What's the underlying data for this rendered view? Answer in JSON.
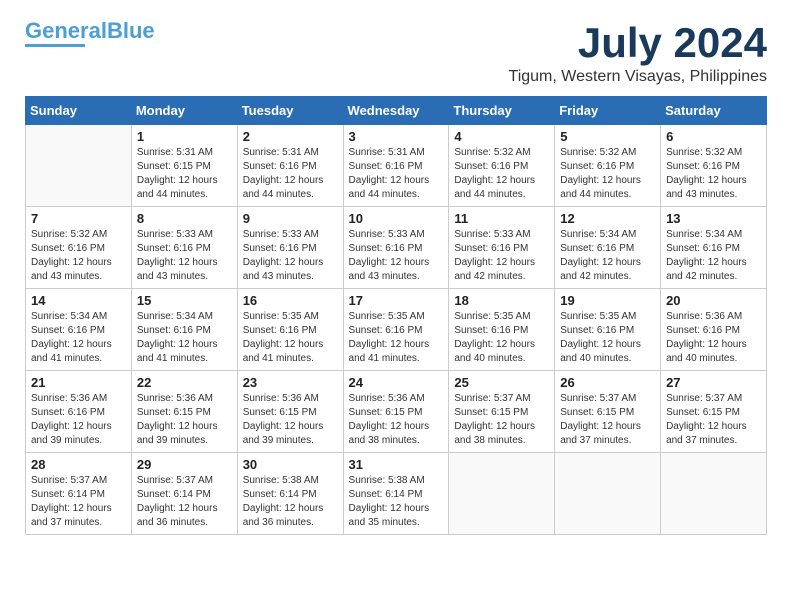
{
  "logo": {
    "line1": "General",
    "line2": "Blue"
  },
  "title": "July 2024",
  "location": "Tigum, Western Visayas, Philippines",
  "days_of_week": [
    "Sunday",
    "Monday",
    "Tuesday",
    "Wednesday",
    "Thursday",
    "Friday",
    "Saturday"
  ],
  "weeks": [
    [
      {
        "day": "",
        "info": ""
      },
      {
        "day": "1",
        "info": "Sunrise: 5:31 AM\nSunset: 6:15 PM\nDaylight: 12 hours\nand 44 minutes."
      },
      {
        "day": "2",
        "info": "Sunrise: 5:31 AM\nSunset: 6:16 PM\nDaylight: 12 hours\nand 44 minutes."
      },
      {
        "day": "3",
        "info": "Sunrise: 5:31 AM\nSunset: 6:16 PM\nDaylight: 12 hours\nand 44 minutes."
      },
      {
        "day": "4",
        "info": "Sunrise: 5:32 AM\nSunset: 6:16 PM\nDaylight: 12 hours\nand 44 minutes."
      },
      {
        "day": "5",
        "info": "Sunrise: 5:32 AM\nSunset: 6:16 PM\nDaylight: 12 hours\nand 44 minutes."
      },
      {
        "day": "6",
        "info": "Sunrise: 5:32 AM\nSunset: 6:16 PM\nDaylight: 12 hours\nand 43 minutes."
      }
    ],
    [
      {
        "day": "7",
        "info": "Sunrise: 5:32 AM\nSunset: 6:16 PM\nDaylight: 12 hours\nand 43 minutes."
      },
      {
        "day": "8",
        "info": "Sunrise: 5:33 AM\nSunset: 6:16 PM\nDaylight: 12 hours\nand 43 minutes."
      },
      {
        "day": "9",
        "info": "Sunrise: 5:33 AM\nSunset: 6:16 PM\nDaylight: 12 hours\nand 43 minutes."
      },
      {
        "day": "10",
        "info": "Sunrise: 5:33 AM\nSunset: 6:16 PM\nDaylight: 12 hours\nand 43 minutes."
      },
      {
        "day": "11",
        "info": "Sunrise: 5:33 AM\nSunset: 6:16 PM\nDaylight: 12 hours\nand 42 minutes."
      },
      {
        "day": "12",
        "info": "Sunrise: 5:34 AM\nSunset: 6:16 PM\nDaylight: 12 hours\nand 42 minutes."
      },
      {
        "day": "13",
        "info": "Sunrise: 5:34 AM\nSunset: 6:16 PM\nDaylight: 12 hours\nand 42 minutes."
      }
    ],
    [
      {
        "day": "14",
        "info": "Sunrise: 5:34 AM\nSunset: 6:16 PM\nDaylight: 12 hours\nand 41 minutes."
      },
      {
        "day": "15",
        "info": "Sunrise: 5:34 AM\nSunset: 6:16 PM\nDaylight: 12 hours\nand 41 minutes."
      },
      {
        "day": "16",
        "info": "Sunrise: 5:35 AM\nSunset: 6:16 PM\nDaylight: 12 hours\nand 41 minutes."
      },
      {
        "day": "17",
        "info": "Sunrise: 5:35 AM\nSunset: 6:16 PM\nDaylight: 12 hours\nand 41 minutes."
      },
      {
        "day": "18",
        "info": "Sunrise: 5:35 AM\nSunset: 6:16 PM\nDaylight: 12 hours\nand 40 minutes."
      },
      {
        "day": "19",
        "info": "Sunrise: 5:35 AM\nSunset: 6:16 PM\nDaylight: 12 hours\nand 40 minutes."
      },
      {
        "day": "20",
        "info": "Sunrise: 5:36 AM\nSunset: 6:16 PM\nDaylight: 12 hours\nand 40 minutes."
      }
    ],
    [
      {
        "day": "21",
        "info": "Sunrise: 5:36 AM\nSunset: 6:16 PM\nDaylight: 12 hours\nand 39 minutes."
      },
      {
        "day": "22",
        "info": "Sunrise: 5:36 AM\nSunset: 6:15 PM\nDaylight: 12 hours\nand 39 minutes."
      },
      {
        "day": "23",
        "info": "Sunrise: 5:36 AM\nSunset: 6:15 PM\nDaylight: 12 hours\nand 39 minutes."
      },
      {
        "day": "24",
        "info": "Sunrise: 5:36 AM\nSunset: 6:15 PM\nDaylight: 12 hours\nand 38 minutes."
      },
      {
        "day": "25",
        "info": "Sunrise: 5:37 AM\nSunset: 6:15 PM\nDaylight: 12 hours\nand 38 minutes."
      },
      {
        "day": "26",
        "info": "Sunrise: 5:37 AM\nSunset: 6:15 PM\nDaylight: 12 hours\nand 37 minutes."
      },
      {
        "day": "27",
        "info": "Sunrise: 5:37 AM\nSunset: 6:15 PM\nDaylight: 12 hours\nand 37 minutes."
      }
    ],
    [
      {
        "day": "28",
        "info": "Sunrise: 5:37 AM\nSunset: 6:14 PM\nDaylight: 12 hours\nand 37 minutes."
      },
      {
        "day": "29",
        "info": "Sunrise: 5:37 AM\nSunset: 6:14 PM\nDaylight: 12 hours\nand 36 minutes."
      },
      {
        "day": "30",
        "info": "Sunrise: 5:38 AM\nSunset: 6:14 PM\nDaylight: 12 hours\nand 36 minutes."
      },
      {
        "day": "31",
        "info": "Sunrise: 5:38 AM\nSunset: 6:14 PM\nDaylight: 12 hours\nand 35 minutes."
      },
      {
        "day": "",
        "info": ""
      },
      {
        "day": "",
        "info": ""
      },
      {
        "day": "",
        "info": ""
      }
    ]
  ]
}
